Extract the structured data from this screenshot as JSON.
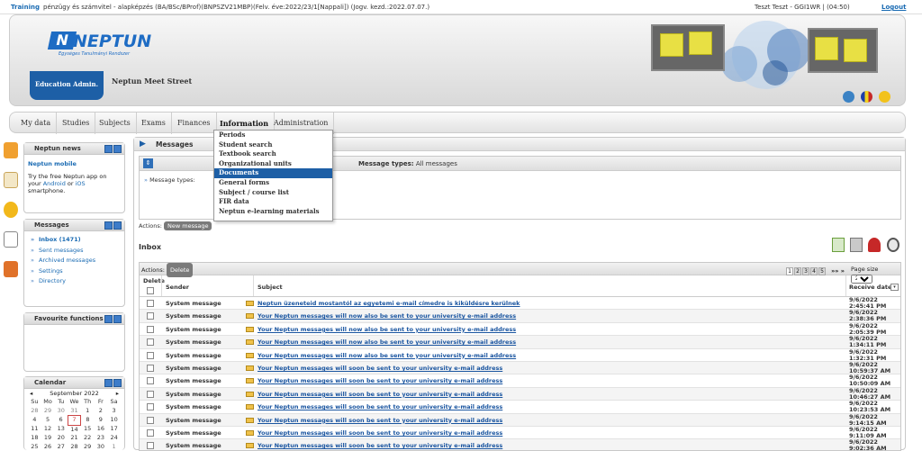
{
  "topbar": {
    "training": "Training",
    "course": "pénzügy és számvitel - alapképzés (BA/BSc/BProf)(BNPSZV21MBP)(Felv. éve:2022/23/1[Nappali]) (Jogv. kezd.:2022.07.07.)",
    "user": "Teszt Teszt - GGI1WR  |  (04:50)",
    "logout": "Logout"
  },
  "header": {
    "logo_text": "NEPTUN",
    "logo_sub": "Egységes Tanulmányi Rendszer",
    "section": "Education Admin.",
    "title": "Neptun Meet Street"
  },
  "menu": {
    "items": [
      "My data",
      "Studies",
      "Subjects",
      "Exams",
      "Finances",
      "Information",
      "Administration"
    ],
    "active": "Information"
  },
  "dropdown": {
    "items": [
      "Periods",
      "Student search",
      "Textbook search",
      "Organizational units",
      "Documents",
      "General forms",
      "Subject / course list",
      "FIR data",
      "Neptun e-learning materials"
    ],
    "selected": "Documents"
  },
  "sidebar": {
    "news": {
      "title": "Neptun news",
      "heading": "Neptun mobile",
      "text1": "Try the free Neptun app on your ",
      "android": "Android",
      "or": " or ",
      "ios": "iOS",
      "text2": " smartphone."
    },
    "messages": {
      "title": "Messages",
      "items": [
        "Inbox (1471)",
        "Sent messages",
        "Archived messages",
        "Settings",
        "Directory"
      ]
    },
    "favourites": {
      "title": "Favourite functions"
    },
    "calendar": {
      "title": "Calendar",
      "month": "September 2022",
      "prev": "◂",
      "next": "▸",
      "days": [
        "Su",
        "Mo",
        "Tu",
        "We",
        "Th",
        "Fr",
        "Sa"
      ],
      "weeks": [
        [
          "28",
          "29",
          "30",
          "31",
          "1",
          "2",
          "3"
        ],
        [
          "4",
          "5",
          "6",
          "7",
          "8",
          "9",
          "10"
        ],
        [
          "11",
          "12",
          "13",
          "14",
          "15",
          "16",
          "17"
        ],
        [
          "18",
          "19",
          "20",
          "21",
          "22",
          "23",
          "24"
        ],
        [
          "25",
          "26",
          "27",
          "28",
          "29",
          "30",
          "1"
        ]
      ],
      "today": "7"
    }
  },
  "main": {
    "title": "Messages",
    "filter": {
      "types_label": "Message types:",
      "types_value": "All messages",
      "body_label": "Message types:"
    },
    "actions_label": "Actions:",
    "new_message": "New message",
    "inbox_title": "Inbox",
    "grid": {
      "actions_label": "Actions:",
      "delete": "Delete",
      "pages": [
        "1",
        "2",
        "3",
        "4",
        "5"
      ],
      "pager_next": "»» »",
      "page_size_label": "Page size",
      "page_size": "20",
      "col_delete": "Delete",
      "col_sender": "Sender",
      "col_subject": "Subject",
      "col_date": "Receive date",
      "rows": [
        {
          "sender": "System message",
          "subject": "Neptun üzeneteid mostantól az egyetemi e-mail címedre is kiküldésre kerülnek",
          "date1": "9/6/2022",
          "date2": "2:45:41 PM"
        },
        {
          "sender": "System message",
          "subject": "Your Neptun messages will now also be sent to your university e-mail address",
          "date1": "9/6/2022",
          "date2": "2:38:36 PM"
        },
        {
          "sender": "System message",
          "subject": "Your Neptun messages will now also be sent to your university e-mail address",
          "date1": "9/6/2022",
          "date2": "2:05:39 PM"
        },
        {
          "sender": "System message",
          "subject": "Your Neptun messages will now also be sent to your university e-mail address",
          "date1": "9/6/2022",
          "date2": "1:34:11 PM"
        },
        {
          "sender": "System message",
          "subject": "Your Neptun messages will now also be sent to your university e-mail address",
          "date1": "9/6/2022",
          "date2": "1:32:31 PM"
        },
        {
          "sender": "System message",
          "subject": "Your Neptun messages will soon be sent to your university e-mail address",
          "date1": "9/6/2022",
          "date2": "10:59:37 AM"
        },
        {
          "sender": "System message",
          "subject": "Your Neptun messages will soon be sent to your university e-mail address",
          "date1": "9/6/2022",
          "date2": "10:50:09 AM"
        },
        {
          "sender": "System message",
          "subject": "Your Neptun messages will soon be sent to your university e-mail address",
          "date1": "9/6/2022",
          "date2": "10:46:27 AM"
        },
        {
          "sender": "System message",
          "subject": "Your Neptun messages will soon be sent to your university e-mail address",
          "date1": "9/6/2022",
          "date2": "10:23:53 AM"
        },
        {
          "sender": "System message",
          "subject": "Your Neptun messages will soon be sent to your university e-mail address",
          "date1": "9/6/2022",
          "date2": "9:14:15 AM"
        },
        {
          "sender": "System message",
          "subject": "Your Neptun messages will soon be sent to your university e-mail address",
          "date1": "9/6/2022",
          "date2": "9:11:09 AM"
        },
        {
          "sender": "System message",
          "subject": "Your Neptun messages will soon be sent to your university e-mail address",
          "date1": "9/6/2022",
          "date2": "9:02:36 AM"
        }
      ]
    }
  }
}
